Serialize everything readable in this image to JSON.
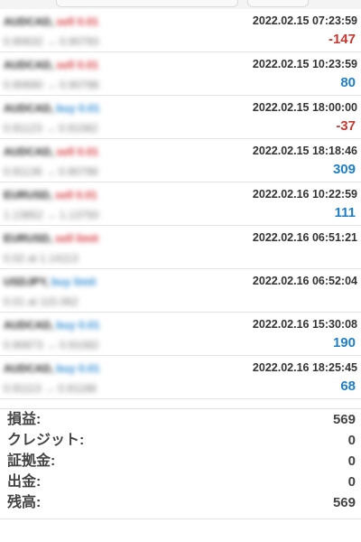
{
  "trades": [
    {
      "symbol": "AUDCAD,",
      "side": "sell 0.01",
      "side_type": "sell",
      "prices": "0.90632 → 0.90793",
      "time": "2022.02.15 07:23:59",
      "profit": "-147",
      "profit_sign": "neg"
    },
    {
      "symbol": "AUDCAD,",
      "side": "sell 0.01",
      "side_type": "sell",
      "prices": "0.90690 → 0.90798",
      "time": "2022.02.15 10:23:59",
      "profit": "80",
      "profit_sign": "pos"
    },
    {
      "symbol": "AUDCAD,",
      "side": "buy 0.01",
      "side_type": "buy",
      "prices": "0.91123 → 0.91082",
      "time": "2022.02.15 18:00:00",
      "profit": "-37",
      "profit_sign": "neg"
    },
    {
      "symbol": "AUDCAD,",
      "side": "sell 0.01",
      "side_type": "sell",
      "prices": "0.91136 → 0.90798",
      "time": "2022.02.15 18:18:46",
      "profit": "309",
      "profit_sign": "pos"
    },
    {
      "symbol": "EURUSD,",
      "side": "sell 0.01",
      "side_type": "sell",
      "prices": "1.13852 → 1.13750",
      "time": "2022.02.16 10:22:59",
      "profit": "111",
      "profit_sign": "pos"
    },
    {
      "symbol": "EURUSD,",
      "side": "sell limit",
      "side_type": "sell",
      "prices": "0.02 at 1.14113",
      "time": "2022.02.16 06:51:21",
      "profit": "",
      "profit_sign": "pos"
    },
    {
      "symbol": "USDJPY,",
      "side": "buy limit",
      "side_type": "buy",
      "prices": "0.01 at 115.062",
      "time": "2022.02.16 06:52:04",
      "profit": "",
      "profit_sign": "pos"
    },
    {
      "symbol": "AUDCAD,",
      "side": "buy 0.01",
      "side_type": "buy",
      "prices": "0.90873 → 0.91082",
      "time": "2022.02.16 15:30:08",
      "profit": "190",
      "profit_sign": "pos"
    },
    {
      "symbol": "AUDCAD,",
      "side": "buy 0.01",
      "side_type": "buy",
      "prices": "0.91113 → 0.91188",
      "time": "2022.02.16 18:25:45",
      "profit": "68",
      "profit_sign": "pos"
    }
  ],
  "summary": [
    {
      "label": "損益:",
      "value": "569"
    },
    {
      "label": "クレジット:",
      "value": "0"
    },
    {
      "label": "証拠金:",
      "value": "0"
    },
    {
      "label": "出金:",
      "value": "0"
    },
    {
      "label": "残高:",
      "value": "569"
    }
  ]
}
